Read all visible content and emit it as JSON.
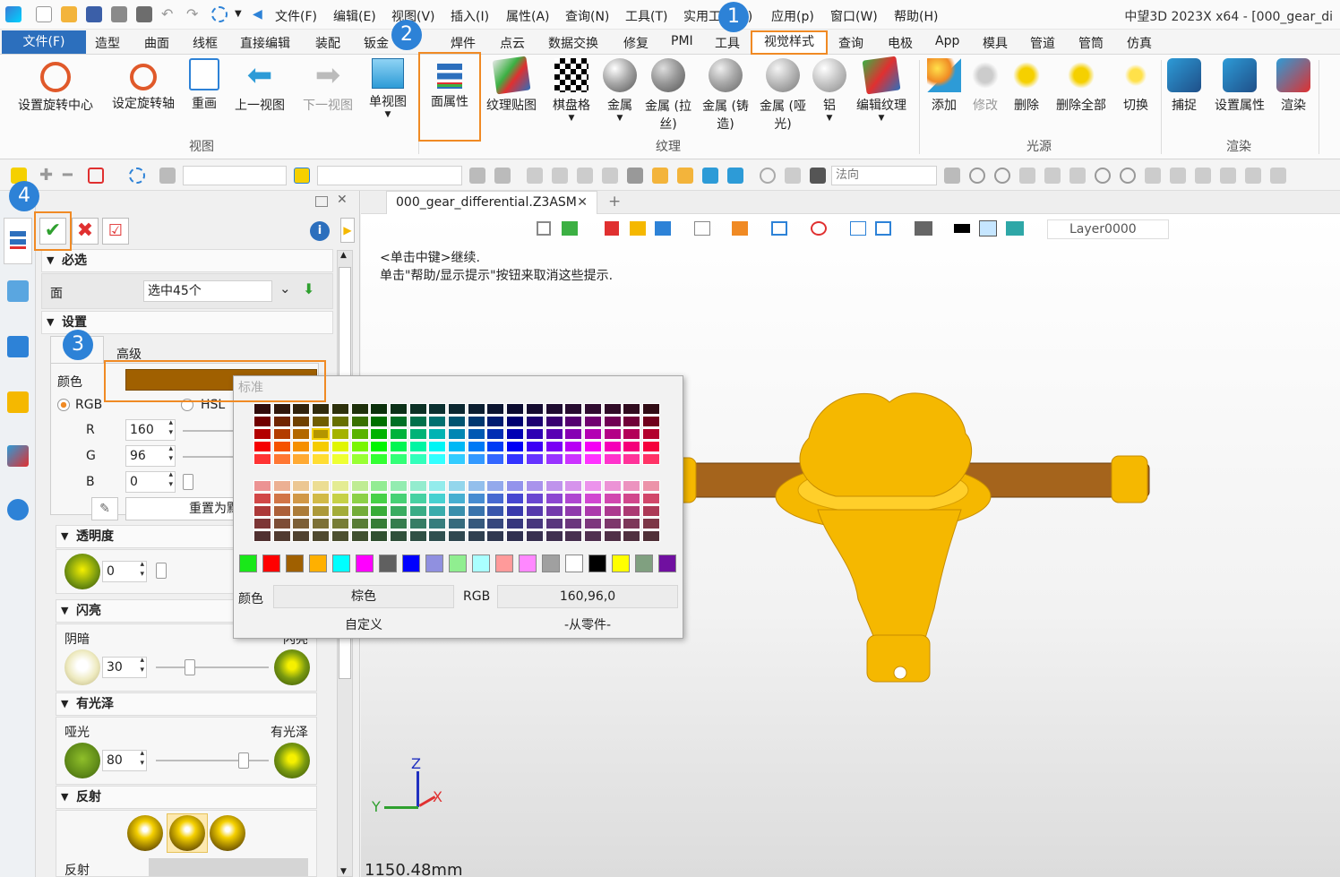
{
  "menubar": {
    "items": [
      "文件(F)",
      "编辑(E)",
      "视图(V)",
      "插入(I)",
      "属性(A)",
      "查询(N)",
      "工具(T)",
      "实用工具(U)",
      "应用(p)",
      "窗口(W)",
      "帮助(H)"
    ],
    "app_title": "中望3D 2023X x64 - [000_gear_di"
  },
  "tabs": {
    "file": "文件(F)",
    "items": [
      "造型",
      "曲面",
      "线框",
      "直接编辑",
      "装配",
      "钣金",
      "焊件",
      "点云",
      "数据交换",
      "修复",
      "PMI",
      "工具"
    ],
    "visual_style": "视觉样式",
    "right_items": [
      "查询",
      "电极",
      "App",
      "模具",
      "管道",
      "管筒",
      "仿真"
    ]
  },
  "ribbon": {
    "view_group": {
      "label": "视图",
      "buttons": [
        "设置旋转中心",
        "设定旋转轴",
        "重画",
        "上一视图",
        "下一视图",
        "单视图"
      ]
    },
    "texture_group": {
      "label": "纹理",
      "buttons": [
        "面属性",
        "纹理贴图",
        "棋盘格",
        "金属",
        "金属 (拉丝)",
        "金属 (铸造)",
        "金属 (哑光)",
        "铝",
        "编辑纹理"
      ]
    },
    "light_group": {
      "label": "光源",
      "buttons": [
        "添加",
        "修改",
        "删除",
        "删除全部",
        "切换"
      ]
    },
    "render_group": {
      "label": "渲染",
      "buttons": [
        "捕捉",
        "设置属性",
        "渲染"
      ]
    }
  },
  "toolbar2": {
    "normal_combo": "法向",
    "layer_combo": "Layer0000"
  },
  "doc": {
    "tab_title": "000_gear_differential.Z3ASM",
    "hint_line1": "<单击中键>继续.",
    "hint_line2": "单击\"帮助/显示提示\"按钮来取消这些提示.",
    "scale": "1150.48mm",
    "axis_x": "X",
    "axis_y": "Y",
    "axis_z": "Z"
  },
  "panel": {
    "required_header": "必选",
    "face_label": "面",
    "face_value": "选中45个",
    "settings_header": "设置",
    "advanced_tab": "高级",
    "color_label": "颜色",
    "rgb_option": "RGB",
    "hsl_option": "HSL",
    "r_label": "R",
    "r_value": "160",
    "g_label": "G",
    "g_value": "96",
    "b_label": "B",
    "b_value": "0",
    "reset_button": "重置为默",
    "transparency_header": "透明度",
    "transparency_value": "0",
    "shine_header": "闪亮",
    "dark_label": "阴暗",
    "shine_label": "闪亮",
    "shine_value": "30",
    "gloss_header": "有光泽",
    "matte_label": "哑光",
    "gloss_label": "有光泽",
    "gloss_value": "80",
    "reflect_header": "反射",
    "reflect_label": "反射"
  },
  "popup": {
    "standard_label": "标准",
    "color_label": "颜色",
    "color_name": "棕色",
    "rgb_label": "RGB",
    "rgb_value": "160,96,0",
    "custom_button": "自定义",
    "from_part_button": "-从零件-"
  },
  "annotations": [
    "1",
    "2",
    "3",
    "4"
  ],
  "colors": {
    "accent": "#2c6fbd",
    "highlight_box": "#f08a24",
    "selected_color": "#a06000",
    "model": "#f5b800"
  }
}
